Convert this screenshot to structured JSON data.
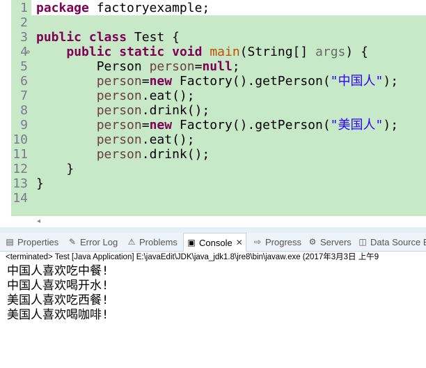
{
  "editor": {
    "lines": [
      {
        "n": "1",
        "tokens": [
          {
            "t": "package",
            "c": "kw"
          },
          {
            "t": " factoryexample;",
            "c": ""
          }
        ]
      },
      {
        "n": "2",
        "tokens": []
      },
      {
        "n": "3",
        "tokens": [
          {
            "t": "public",
            "c": "kw"
          },
          {
            "t": " ",
            "c": ""
          },
          {
            "t": "class",
            "c": "kw"
          },
          {
            "t": " Test {",
            "c": ""
          }
        ]
      },
      {
        "n": "4",
        "fold": true,
        "tokens": [
          {
            "t": "    ",
            "c": ""
          },
          {
            "t": "public",
            "c": "kw"
          },
          {
            "t": " ",
            "c": ""
          },
          {
            "t": "static",
            "c": "kw"
          },
          {
            "t": " ",
            "c": ""
          },
          {
            "t": "void",
            "c": "kw"
          },
          {
            "t": " ",
            "c": ""
          },
          {
            "t": "main",
            "c": "mth"
          },
          {
            "t": "(String[] ",
            "c": ""
          },
          {
            "t": "args",
            "c": "prm"
          },
          {
            "t": ") {",
            "c": ""
          }
        ]
      },
      {
        "n": "5",
        "tokens": [
          {
            "t": "        Person ",
            "c": ""
          },
          {
            "t": "person",
            "c": "var"
          },
          {
            "t": "=",
            "c": ""
          },
          {
            "t": "null",
            "c": "kw"
          },
          {
            "t": ";",
            "c": ""
          }
        ]
      },
      {
        "n": "6",
        "tokens": [
          {
            "t": "        ",
            "c": ""
          },
          {
            "t": "person",
            "c": "var"
          },
          {
            "t": "=",
            "c": ""
          },
          {
            "t": "new",
            "c": "kw"
          },
          {
            "t": " Factory().getPerson(",
            "c": ""
          },
          {
            "t": "\"中国人\"",
            "c": "str"
          },
          {
            "t": ");",
            "c": ""
          }
        ]
      },
      {
        "n": "7",
        "tokens": [
          {
            "t": "        ",
            "c": ""
          },
          {
            "t": "person",
            "c": "var"
          },
          {
            "t": ".eat();",
            "c": ""
          }
        ]
      },
      {
        "n": "8",
        "tokens": [
          {
            "t": "        ",
            "c": ""
          },
          {
            "t": "person",
            "c": "var"
          },
          {
            "t": ".drink();",
            "c": ""
          }
        ]
      },
      {
        "n": "9",
        "tokens": [
          {
            "t": "        ",
            "c": ""
          },
          {
            "t": "person",
            "c": "var"
          },
          {
            "t": "=",
            "c": ""
          },
          {
            "t": "new",
            "c": "kw"
          },
          {
            "t": " Factory().getPerson(",
            "c": ""
          },
          {
            "t": "\"美国人\"",
            "c": "str"
          },
          {
            "t": ");",
            "c": ""
          }
        ]
      },
      {
        "n": "10",
        "tokens": [
          {
            "t": "        ",
            "c": ""
          },
          {
            "t": "person",
            "c": "var"
          },
          {
            "t": ".eat();",
            "c": ""
          }
        ]
      },
      {
        "n": "11",
        "tokens": [
          {
            "t": "        ",
            "c": ""
          },
          {
            "t": "person",
            "c": "var"
          },
          {
            "t": ".drink();",
            "c": ""
          }
        ]
      },
      {
        "n": "12",
        "tokens": [
          {
            "t": "    }",
            "c": ""
          }
        ]
      },
      {
        "n": "13",
        "tokens": [
          {
            "t": "}",
            "c": ""
          }
        ]
      },
      {
        "n": "14",
        "tokens": []
      }
    ]
  },
  "panel": {
    "tabs": [
      {
        "label": "Properties",
        "icon": "properties-icon",
        "glyph": "▤"
      },
      {
        "label": "Error Log",
        "icon": "error-log-icon",
        "glyph": "✎"
      },
      {
        "label": "Problems",
        "icon": "problems-icon",
        "glyph": "⚠"
      },
      {
        "label": "Console",
        "icon": "console-icon",
        "glyph": "▣",
        "active": true,
        "close": "✕"
      },
      {
        "label": "Progress",
        "icon": "progress-icon",
        "glyph": "⇨"
      },
      {
        "label": "Servers",
        "icon": "servers-icon",
        "glyph": "⚙"
      },
      {
        "label": "Data Source E",
        "icon": "data-source-icon",
        "glyph": "◫"
      }
    ],
    "launch_info": "<terminated> Test [Java Application] E:\\javaEdit\\JDK\\java_jdk1.8\\jre8\\bin\\javaw.exe (2017年3月3日 上午9",
    "output": [
      "中国人喜欢吃中餐!",
      "中国人喜欢喝开水!",
      "美国人喜欢吃西餐!",
      "美国人喜欢喝咖啡!"
    ]
  },
  "colors": {
    "highlight": "#c7e9c7",
    "keyword": "#7f0055",
    "string": "#2a00ff",
    "method": "#c05000"
  }
}
